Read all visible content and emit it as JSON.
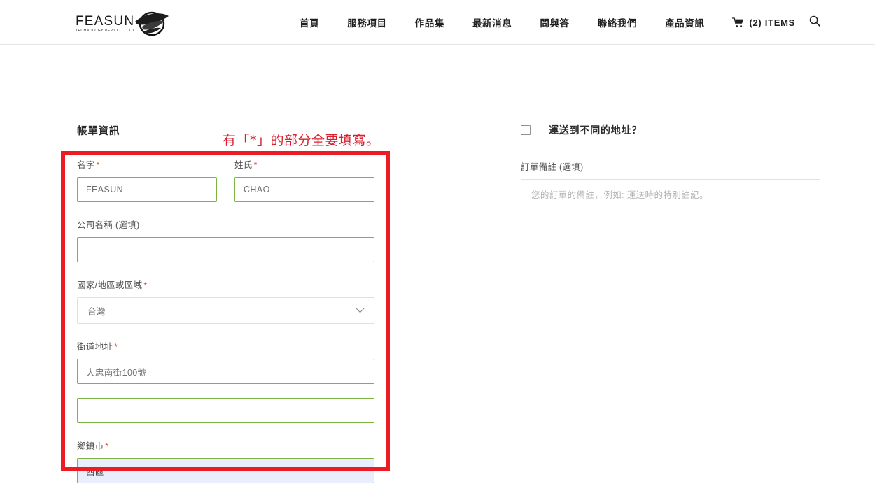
{
  "header": {
    "logo": {
      "word": "FEASUN",
      "sub": "TECHNOLOGY DEPT CO., LTD.",
      "mark_icon": "leaf-swoosh-logo-icon"
    },
    "nav_items": [
      {
        "label": "首頁"
      },
      {
        "label": "服務項目"
      },
      {
        "label": "作品集"
      },
      {
        "label": "最新消息"
      },
      {
        "label": "問與答"
      },
      {
        "label": "聯絡我們"
      },
      {
        "label": "產品資訊"
      }
    ],
    "cart": {
      "icon": "shopping-cart-icon",
      "label": "(2) ITEMS"
    },
    "search": {
      "icon": "search-icon"
    }
  },
  "billing": {
    "title": "帳單資訊",
    "first_name": {
      "label": "名字",
      "required_mark": "*",
      "value": "FEASUN",
      "placeholder": ""
    },
    "last_name": {
      "label": "姓氏",
      "required_mark": "*",
      "value": "CHAO",
      "placeholder": ""
    },
    "company": {
      "label": "公司名稱 (選填)",
      "value": "",
      "placeholder": ""
    },
    "country": {
      "label": "國家/地區或區域",
      "required_mark": "*",
      "value": "台灣",
      "chevron_icon": "chevron-down-icon"
    },
    "street": {
      "label": "街道地址",
      "required_mark": "*",
      "value": "大忠南街100號",
      "placeholder": ""
    },
    "street2": {
      "value": "",
      "placeholder": ""
    },
    "city": {
      "label": "鄉鎮市",
      "required_mark": "*",
      "value": "西區",
      "placeholder": ""
    }
  },
  "shipping": {
    "checkbox_label": "運送到不同的地址？",
    "checked": false,
    "order_note": {
      "label": "訂單備註 (選填)",
      "value": "",
      "placeholder": "您的訂單的備註，例如: 運送時的特別註記。"
    }
  },
  "annotation": {
    "text": "有「*」的部分全要填寫。",
    "color": "#d8202f",
    "box_color": "#ed1c24"
  }
}
